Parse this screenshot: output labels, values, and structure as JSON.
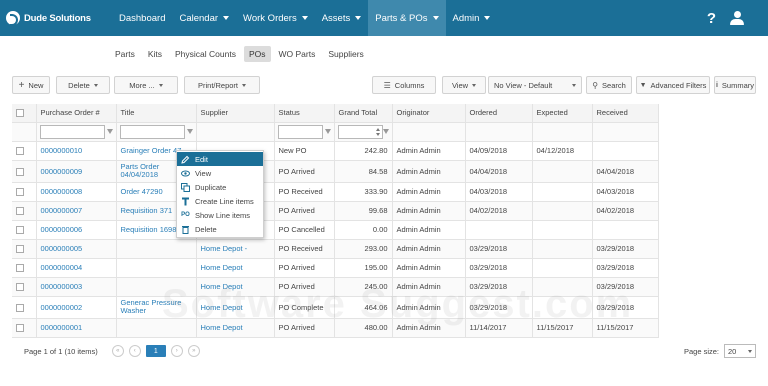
{
  "app": {
    "brand": "Dude Solutions"
  },
  "topnav": {
    "items": [
      {
        "label": "Dashboard",
        "dropdown": false
      },
      {
        "label": "Calendar",
        "dropdown": true
      },
      {
        "label": "Work Orders",
        "dropdown": true
      },
      {
        "label": "Assets",
        "dropdown": true
      },
      {
        "label": "Parts & POs",
        "dropdown": true,
        "active": true
      },
      {
        "label": "Admin",
        "dropdown": true
      }
    ],
    "help_label": "?"
  },
  "subnav": {
    "tabs": [
      "Parts",
      "Kits",
      "Physical Counts",
      "POs",
      "WO Parts",
      "Suppliers"
    ],
    "active": "POs"
  },
  "toolbar": {
    "new": "New",
    "delete": "Delete",
    "more": "More ...",
    "print": "Print/Report",
    "columns": "Columns",
    "view": "View",
    "view_select": "No View - Default",
    "search": "Search",
    "advanced_filters": "Advanced Filters",
    "summary": "Summary"
  },
  "table": {
    "columns": [
      "Purchase Order #",
      "Title",
      "Supplier",
      "Status",
      "Grand Total",
      "Originator",
      "Ordered",
      "Expected",
      "Received"
    ],
    "rows": [
      {
        "po": "0000000010",
        "title": "Grainger Order 47",
        "supplier": "",
        "status": "New PO",
        "total": "242.80",
        "originator": "Admin Admin",
        "ordered": "04/09/2018",
        "expected": "04/12/2018",
        "received": ""
      },
      {
        "po": "0000000009",
        "title": "Parts Order 04/04/2018",
        "supplier": "",
        "status": "PO Arrived",
        "total": "84.58",
        "originator": "Admin Admin",
        "ordered": "04/04/2018",
        "expected": "",
        "received": "04/04/2018"
      },
      {
        "po": "0000000008",
        "title": "Order 47290",
        "supplier": "",
        "status": "PO Received",
        "total": "333.90",
        "originator": "Admin Admin",
        "ordered": "04/03/2018",
        "expected": "",
        "received": "04/03/2018"
      },
      {
        "po": "0000000007",
        "title": "Requisition 371",
        "supplier": "",
        "status": "PO Arrived",
        "total": "99.68",
        "originator": "Admin Admin",
        "ordered": "04/02/2018",
        "expected": "",
        "received": "04/02/2018"
      },
      {
        "po": "0000000006",
        "title": "Requisition 16987",
        "supplier": "",
        "status": "PO Cancelled",
        "total": "0.00",
        "originator": "Admin Admin",
        "ordered": "",
        "expected": "",
        "received": ""
      },
      {
        "po": "0000000005",
        "title": "",
        "supplier": "Home Depot -",
        "status": "PO Received",
        "total": "293.00",
        "originator": "Admin Admin",
        "ordered": "03/29/2018",
        "expected": "",
        "received": "03/29/2018"
      },
      {
        "po": "0000000004",
        "title": "",
        "supplier": "Home Depot",
        "status": "PO Arrived",
        "total": "195.00",
        "originator": "Admin Admin",
        "ordered": "03/29/2018",
        "expected": "",
        "received": "03/29/2018"
      },
      {
        "po": "0000000003",
        "title": "",
        "supplier": "Home Depot",
        "status": "PO Arrived",
        "total": "245.00",
        "originator": "Admin Admin",
        "ordered": "03/29/2018",
        "expected": "",
        "received": "03/29/2018"
      },
      {
        "po": "0000000002",
        "title": "Generac Pressure Washer",
        "supplier": "Home Depot",
        "status": "PO Complete",
        "total": "464.06",
        "originator": "Admin Admin",
        "ordered": "03/29/2018",
        "expected": "",
        "received": "03/29/2018"
      },
      {
        "po": "0000000001",
        "title": "",
        "supplier": "Home Depot",
        "status": "PO Arrived",
        "total": "480.00",
        "originator": "Admin Admin",
        "ordered": "11/14/2017",
        "expected": "11/15/2017",
        "received": "11/15/2017"
      }
    ]
  },
  "context_menu": {
    "items": [
      "Edit",
      "View",
      "Duplicate",
      "Create Line items",
      "Show Line items",
      "Delete"
    ],
    "hovered": "Edit"
  },
  "footer": {
    "page_info": "Page 1 of 1 (10 items)",
    "current_page": "1",
    "page_size_label": "Page size:",
    "page_size": "20"
  },
  "watermark": "Software Suggest.com",
  "colors": {
    "nav": "#1b6f97",
    "nav_active": "#3f89ad",
    "link": "#2a7fb8"
  }
}
